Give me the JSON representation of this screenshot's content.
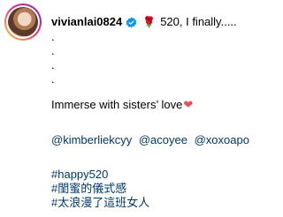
{
  "post": {
    "username": "vivianlai0824",
    "first_line": "520, I finally.....",
    "rose_emoji": "🌹",
    "dots": [
      ".",
      ".",
      ".",
      "."
    ],
    "caption": "Immerse with sisters’ love",
    "heart_emoji": "❤",
    "mentions": [
      "@kimberliekcyy",
      "@acoyee",
      "@xoxoapo"
    ],
    "hashtags": [
      "#happy520",
      "#閨蜜的儀式感",
      "#太浪漫了這班女人"
    ]
  },
  "colors": {
    "link": "#00376b",
    "verified": "#0095f6",
    "heart": "#ed4956"
  }
}
